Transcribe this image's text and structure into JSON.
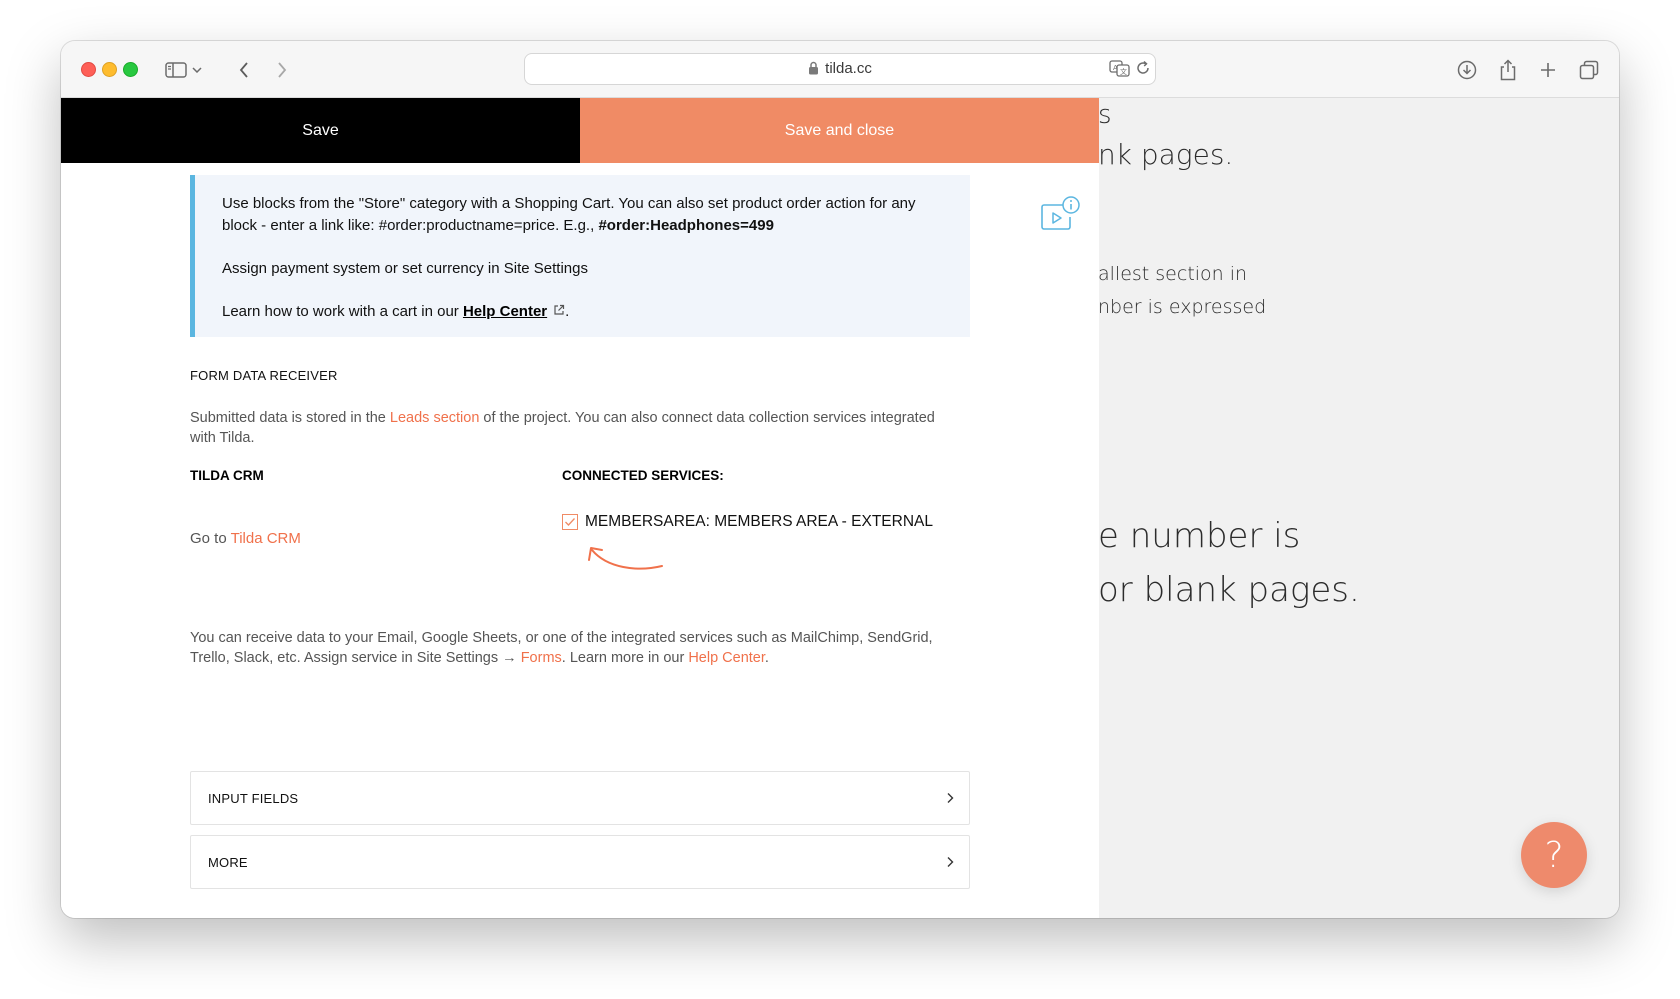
{
  "browser": {
    "url": "tilda.cc"
  },
  "background_page": {
    "lines": [
      "s",
      "nk pages.",
      "allest section in",
      "nber is expressed",
      "e number is",
      "or blank pages."
    ]
  },
  "toolbar": {
    "save_label": "Save",
    "save_close_label": "Save and close"
  },
  "info": {
    "line1_text": "Use blocks from the \"Store\" category with a Shopping Cart. You can also set product order action for any block - enter a link like: #order:productname=price. E.g., ",
    "line1_bold": "#order:Headphones=499",
    "line2": "Assign payment system or set currency in Site Settings",
    "line3_prefix": "Learn how to work with a cart in our ",
    "line3_link": "Help Center",
    "line3_suffix": "."
  },
  "form_receiver": {
    "title": "FORM DATA RECEIVER",
    "desc_prefix": "Submitted data is stored in the ",
    "desc_link": "Leads section",
    "desc_suffix": " of the project. You can also connect data collection services integrated with Tilda.",
    "crm_title": "TILDA CRM",
    "goto_prefix": "Go to ",
    "goto_link": "Tilda CRM",
    "services_title": "CONNECTED SERVICES:",
    "service_label": "MEMBERSAREA: MEMBERS AREA - EXTERNAL",
    "service_checked": true,
    "desc2_prefix": "You can receive data to your Email, Google Sheets, or one of the integrated services such as MailChimp, SendGrid, Trello, Slack, etc. Assign service in Site Settings → ",
    "desc2_link1": "Forms",
    "desc2_mid": ". Learn more in our ",
    "desc2_link2": "Help Center",
    "desc2_suffix": "."
  },
  "sections": {
    "input_fields": "INPUT FIELDS",
    "more": "MORE"
  },
  "help_fab": "?",
  "colors": {
    "accent_orange": "#f08b65",
    "link_orange": "#f0714b",
    "info_border": "#5bb6e0",
    "info_bg": "#f1f5fb",
    "fab": "#ee8a6c"
  },
  "icons": {
    "sidebar": "sidebar-icon",
    "back": "chevron-left-icon",
    "forward": "chevron-right-icon",
    "lock": "lock-icon",
    "translate": "translate-icon",
    "reload": "reload-icon",
    "download": "download-icon",
    "share": "share-icon",
    "new_tab": "plus-icon",
    "tabs": "tabs-overview-icon",
    "video_help": "video-info-icon",
    "external": "external-link-icon",
    "chevron": "chevron-right-icon"
  }
}
